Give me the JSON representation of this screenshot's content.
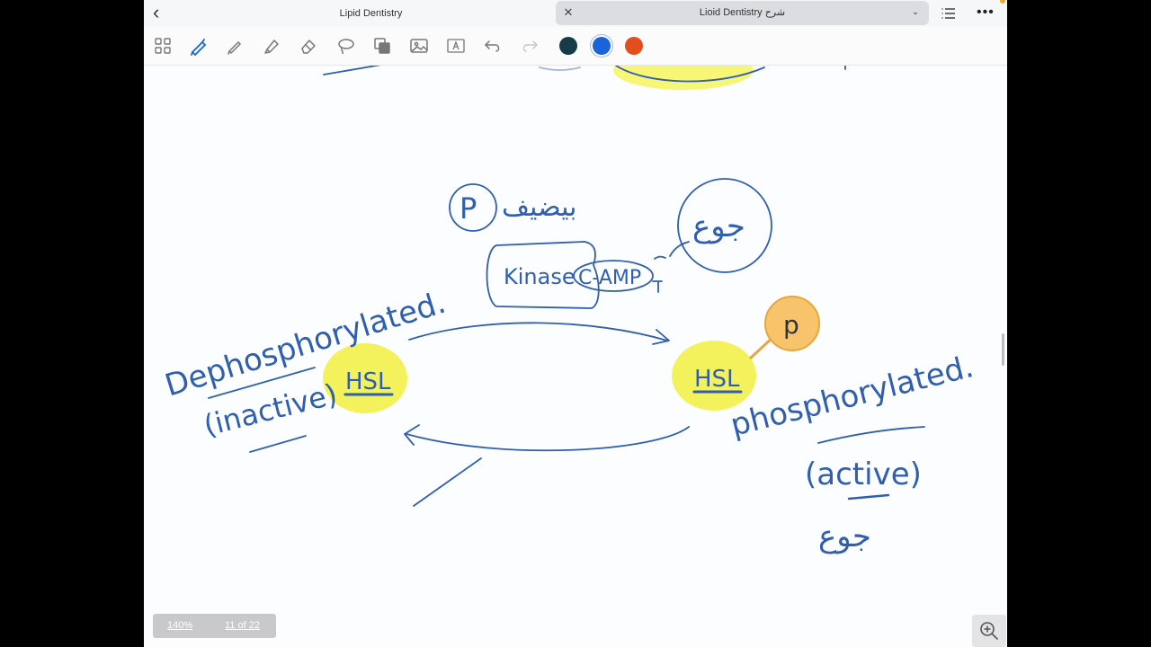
{
  "header": {
    "left_doc_title": "Lipid Dentistry",
    "active_tab_title": "Lioid  Dentistry شرح"
  },
  "toolbar": {
    "colors": [
      "#163c47",
      "#1a63d8",
      "#e24f1c"
    ]
  },
  "canvas": {
    "kinase_label": "Kinase",
    "camp_label": "C-AMP",
    "p_circle_label": "P",
    "hsl_left": "HSL",
    "hsl_right": "HSL",
    "phosphate_label": "p",
    "left_state": "Dephosphorylated.",
    "left_state_note": "(inactive)",
    "right_state": "phosphorylated.",
    "right_state_note": "(active)",
    "arabic_top": "بيضيف",
    "arabic_hunger": "جوع",
    "arabic_bottom": "جوع"
  },
  "status": {
    "zoom": "140%",
    "page": "11 of 22"
  }
}
